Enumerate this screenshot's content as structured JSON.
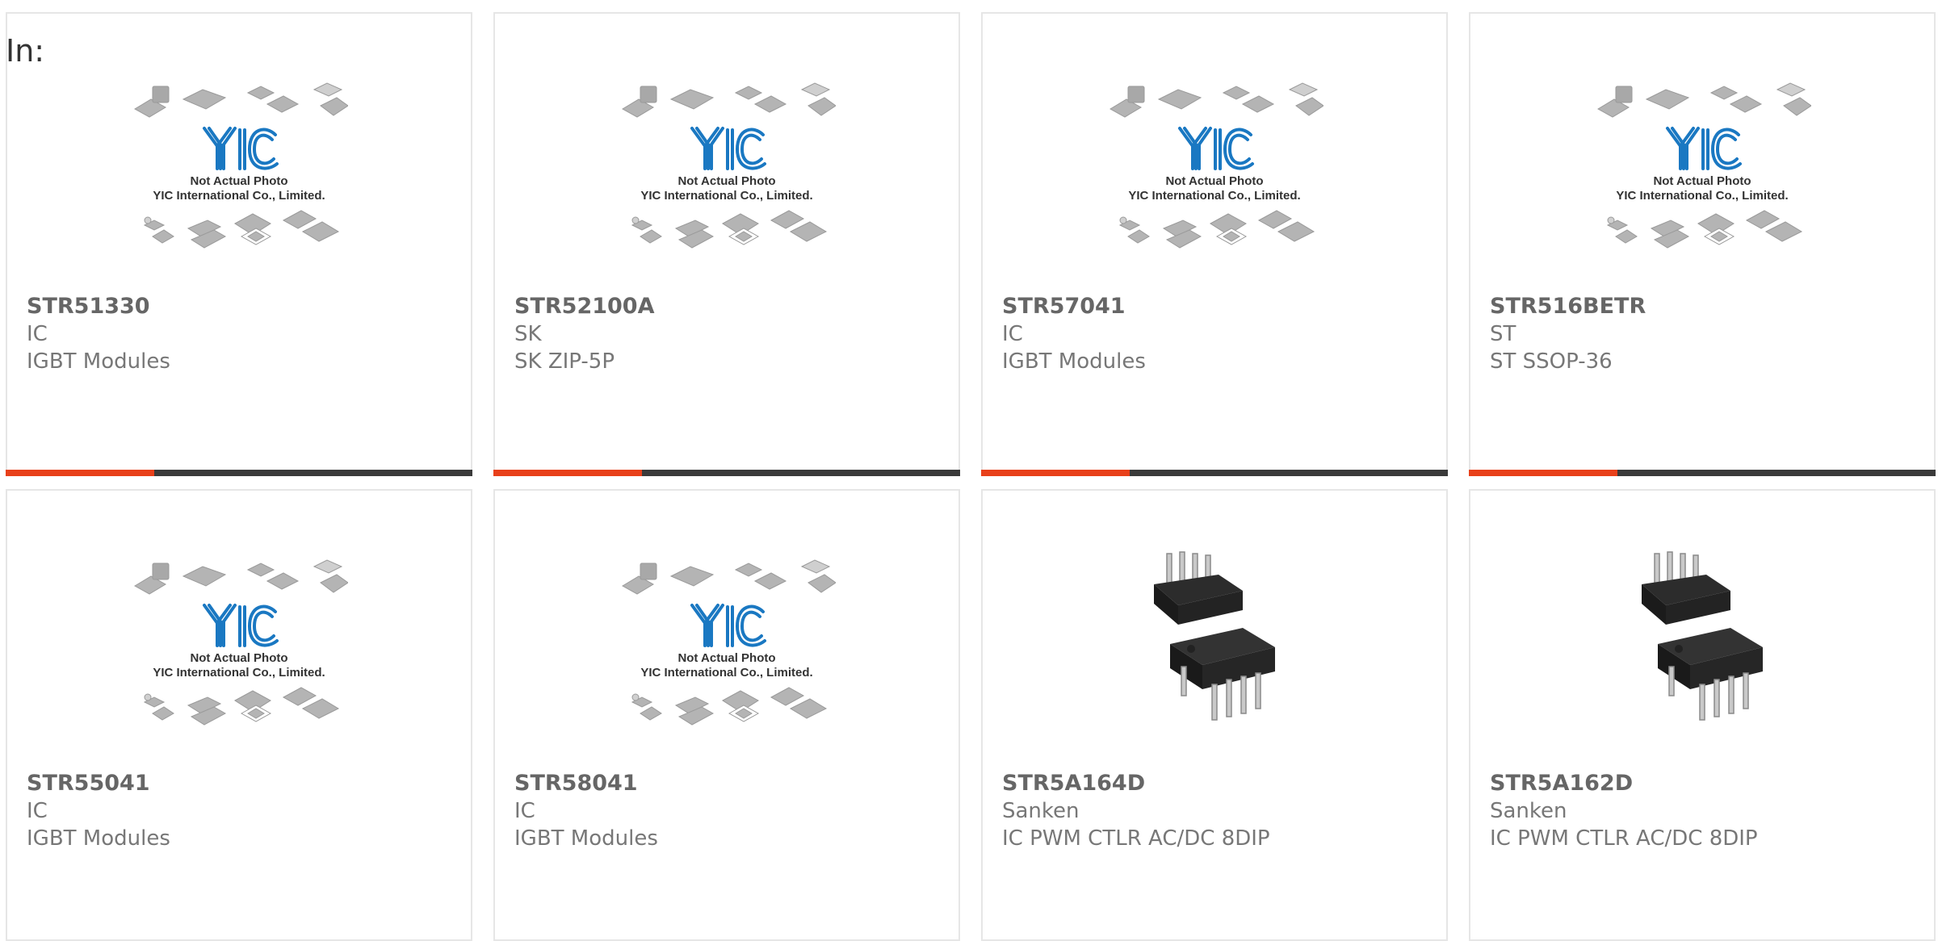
{
  "header": {
    "in_label": "In:"
  },
  "placeholder": {
    "logo_text": "YIC",
    "line1": "Not Actual Photo",
    "line2": "YIC International Co., Limited."
  },
  "colors": {
    "accent": "#e8401a",
    "bar": "#3a3a3a",
    "logo_blue": "#1a78c2"
  },
  "products": [
    {
      "part": "STR51330",
      "manufacturer": "IC",
      "description": "IGBT Modules",
      "image": "placeholder-logo"
    },
    {
      "part": "STR52100A",
      "manufacturer": "SK",
      "description": "SK ZIP-5P",
      "image": "placeholder-logo"
    },
    {
      "part": "STR57041",
      "manufacturer": "IC",
      "description": "IGBT Modules",
      "image": "placeholder-logo"
    },
    {
      "part": "STR516BETR",
      "manufacturer": "ST",
      "description": "ST SSOP-36",
      "image": "placeholder-logo"
    },
    {
      "part": "STR55041",
      "manufacturer": "IC",
      "description": "IGBT Modules",
      "image": "placeholder-logo"
    },
    {
      "part": "STR58041",
      "manufacturer": "IC",
      "description": "IGBT Modules",
      "image": "placeholder-logo"
    },
    {
      "part": "STR5A164D",
      "manufacturer": "Sanken",
      "description": "IC PWM CTLR AC/DC 8DIP",
      "image": "dip8-photo"
    },
    {
      "part": "STR5A162D",
      "manufacturer": "Sanken",
      "description": "IC PWM CTLR AC/DC 8DIP",
      "image": "dip8-photo"
    }
  ]
}
